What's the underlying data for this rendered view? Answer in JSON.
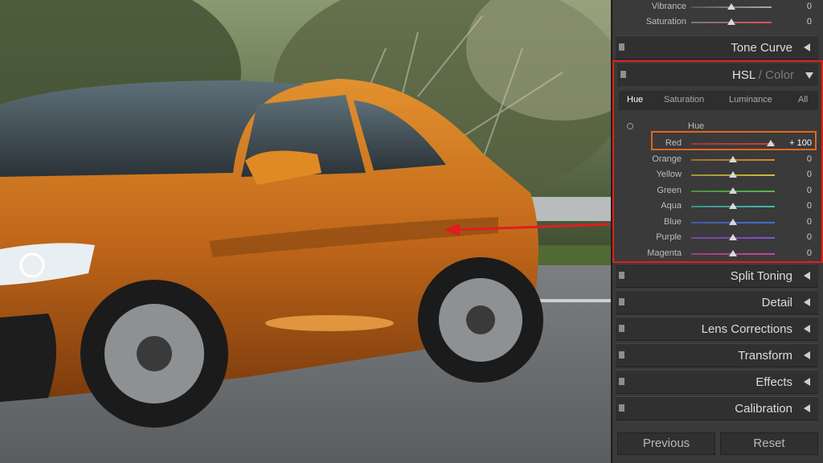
{
  "basic": {
    "rows": [
      {
        "label": "Vibrance",
        "value": "0"
      },
      {
        "label": "Saturation",
        "value": "0"
      }
    ]
  },
  "sections": {
    "tone_curve": "Tone Curve",
    "split_toning": "Split Toning",
    "detail": "Detail",
    "lens_corrections": "Lens Corrections",
    "transform": "Transform",
    "effects": "Effects",
    "calibration": "Calibration"
  },
  "hsl": {
    "title_main": "HSL",
    "title_sep": " / ",
    "title_sub": "Color",
    "tabs": [
      "Hue",
      "Saturation",
      "Luminance",
      "All"
    ],
    "active_tab": "Hue",
    "group_label": "Hue",
    "rows": [
      {
        "label": "Red",
        "value": "+ 100",
        "level": 1.0,
        "color": "#d23c3c"
      },
      {
        "label": "Orange",
        "value": "0",
        "level": 0.5,
        "color": "#d6892d"
      },
      {
        "label": "Yellow",
        "value": "0",
        "level": 0.5,
        "color": "#c9c13a"
      },
      {
        "label": "Green",
        "value": "0",
        "level": 0.5,
        "color": "#58b84a"
      },
      {
        "label": "Aqua",
        "value": "0",
        "level": 0.5,
        "color": "#3fb8b0"
      },
      {
        "label": "Blue",
        "value": "0",
        "level": 0.5,
        "color": "#3f6fd6"
      },
      {
        "label": "Purple",
        "value": "0",
        "level": 0.5,
        "color": "#8a4fd0"
      },
      {
        "label": "Magenta",
        "value": "0",
        "level": 0.5,
        "color": "#c9459e"
      }
    ]
  },
  "buttons": {
    "previous": "Previous",
    "reset": "Reset"
  },
  "colors": {
    "highlight": "#e0201a",
    "car": "#c6701a",
    "arrow": "#e01e1e"
  }
}
